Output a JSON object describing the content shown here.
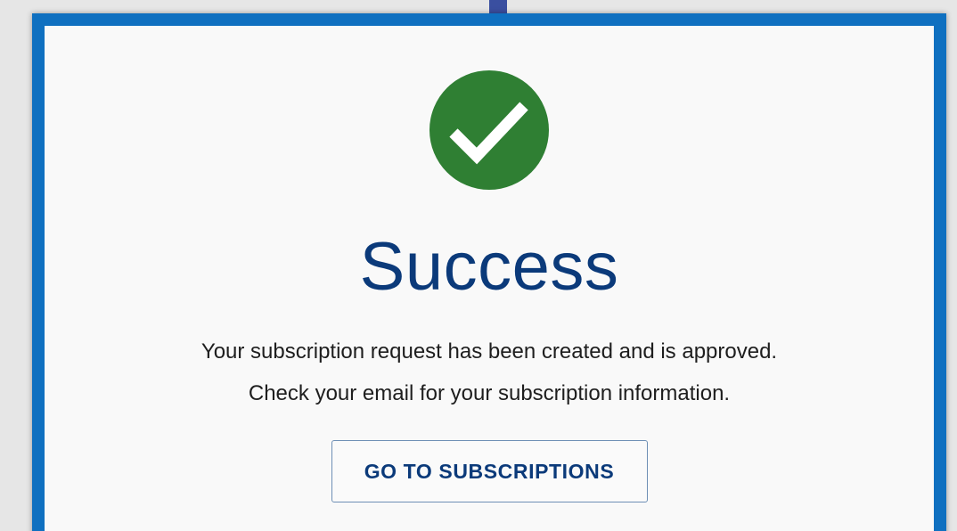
{
  "dialog": {
    "icon": "check-circle-icon",
    "title": "Success",
    "message_line_1": "Your subscription request has been created and is approved.",
    "message_line_2": "Check your email for your subscription information.",
    "button_label": "GO TO SUBSCRIPTIONS"
  },
  "colors": {
    "frame_border": "#0f70c0",
    "success_green": "#2f7f33",
    "title_blue": "#0b3a7a",
    "button_border": "#6e8fb5",
    "connector": "#3a4fa0"
  }
}
